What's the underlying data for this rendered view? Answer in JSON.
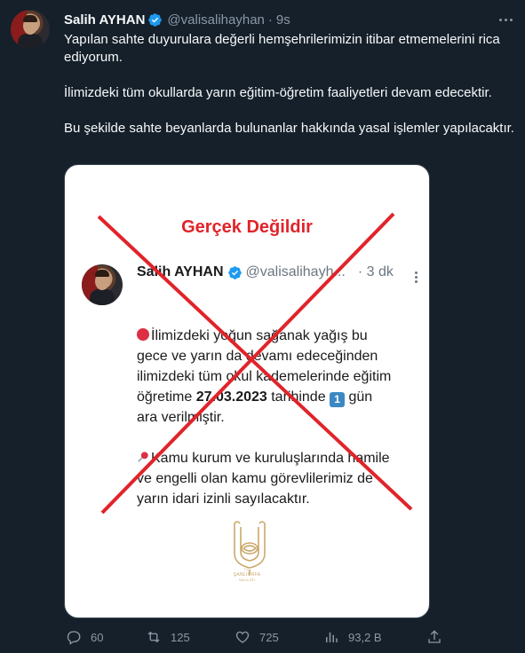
{
  "tweet": {
    "author_name": "Salih AYHAN",
    "handle": "@valisalihayhan",
    "separator": "·",
    "time": "9s",
    "paragraphs": [
      "Yapılan sahte duyurulara değerli hemşehrilerimizin itibar etmemelerini rica ediyorum.",
      "İlimizdeki tüm okullarda yarın eğitim-öğretim faaliyetleri devam edecektir.",
      "Bu şekilde sahte beyanlarda bulunanlar hakkında yasal işlemler yapılacaktır."
    ]
  },
  "image": {
    "stamp": "Gerçek Değildir",
    "inner_name": "Salih AYHAN",
    "inner_handle": "@valisalihayh...",
    "inner_sep": "·",
    "inner_time": "3 dk",
    "inner_line1": "İlimizdeki yoğun sağanak yağış bu",
    "inner_line2": "gece ve yarın da devamı edeceğinden",
    "inner_line3": "ilimizdeki tüm okul kademelerinde eğitim",
    "inner_line4_pre": "öğretime ",
    "inner_date": "27.03.2023",
    "inner_line4_post": " tarihinde ",
    "inner_one": "1",
    "inner_line4_end": " gün",
    "inner_line5": "ara verilmiştir.",
    "inner_line6": "Kamu kurum ve kuruluşlarında hamile",
    "inner_line7": "ve engelli olan kamu görevlilerimiz de",
    "inner_line8": "yarın idari izinli sayılacaktır.",
    "logo_text_top": "T.C.",
    "logo_text_main": "ŞANLIURFA",
    "logo_text_sub": "VALİLİĞİ"
  },
  "actions": {
    "replies": "60",
    "retweets": "125",
    "likes": "725",
    "views": "93,2 B"
  },
  "colors": {
    "background": "#15202b",
    "verified": "#1d9bf0",
    "stamp_red": "#e0242a"
  }
}
